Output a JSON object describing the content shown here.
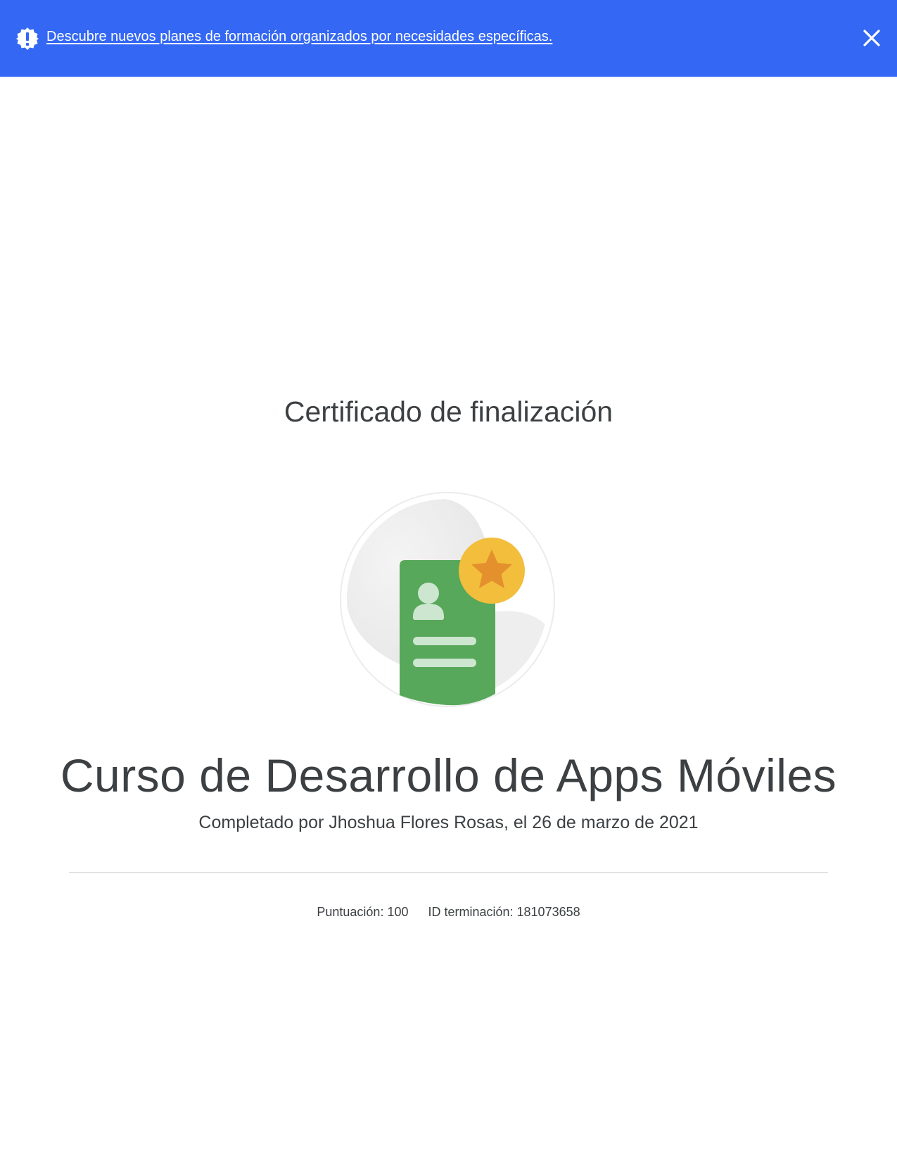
{
  "banner": {
    "icon": "alert-badge-icon",
    "link_text": "Descubre nuevos planes de formación organizados por necesidades específicas.",
    "close_icon": "close-icon",
    "background": "#3367f4"
  },
  "certificate": {
    "heading": "Certificado de finalización",
    "badge_icon": "certificate-star-badge-icon",
    "course_title": "Curso de Desarrollo de Apps Móviles",
    "completed_by": "Completado por Jhoshua Flores Rosas, el 26 de marzo de 2021",
    "score": "Puntuación: 100",
    "completion_id": "ID terminación: 181073658"
  },
  "colors": {
    "text": "#3c4043",
    "badge_green": "#57a85a",
    "badge_gold": "#f2be3c",
    "badge_star": "#e4902d"
  }
}
